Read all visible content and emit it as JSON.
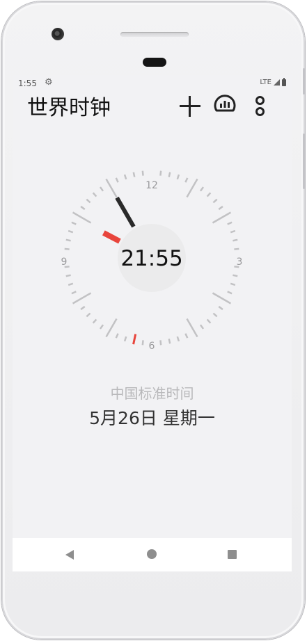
{
  "status_bar": {
    "time": "1:55",
    "network": "LTE",
    "icons": [
      "gear-icon",
      "signal-icon",
      "battery-icon"
    ]
  },
  "header": {
    "title": "世界时钟",
    "actions": [
      "add-icon",
      "speedometer-icon",
      "more-vert-icon"
    ]
  },
  "clock": {
    "digital_time": "21:55",
    "labels": {
      "top": "12",
      "right": "3",
      "bottom": "6",
      "left": "9"
    },
    "hour": 21,
    "minute": 55,
    "second": 32,
    "colors": {
      "hands": "#2a2a2a",
      "second_hand": "#e8453c",
      "ticks": "#c2c2c4",
      "center_disc": "#ebebec"
    }
  },
  "location": {
    "zone_name": "中国标准时间",
    "date": "5月26日 星期一"
  },
  "navbar": {
    "buttons": [
      "back-icon",
      "home-icon",
      "recents-icon"
    ]
  }
}
